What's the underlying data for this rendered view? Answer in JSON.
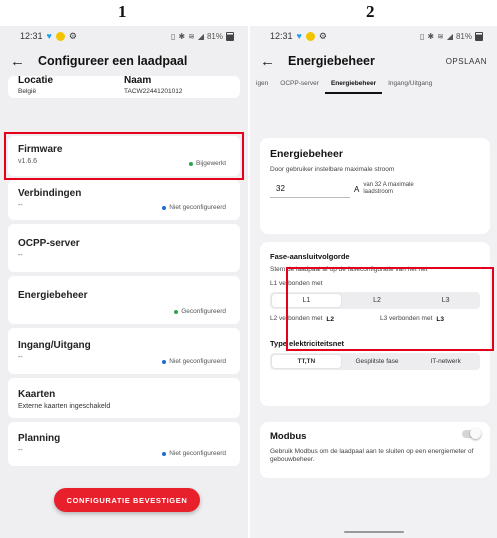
{
  "labels": {
    "step1": "1",
    "step2": "2"
  },
  "status_bar": {
    "time": "12:31",
    "battery": "81%",
    "icons_left": [
      "twitter-bird-icon",
      "sun-icon",
      "app-icon"
    ],
    "icons_right": [
      "vibrate-icon",
      "mute-icon",
      "bluetooth-icon",
      "wifi-icon",
      "signal-icon",
      "battery-icon"
    ]
  },
  "screen1": {
    "title": "Configureer een laadpaal",
    "info": [
      {
        "title": "Locatie",
        "value": "België"
      },
      {
        "title": "Naam",
        "value": "TACW22441201012"
      }
    ],
    "menu": [
      {
        "title": "Firmware",
        "value": "v1.6.6",
        "status": "Bijgewerkt",
        "status_color": "#2ea44f"
      },
      {
        "title": "Verbindingen",
        "value": "--",
        "status": "Niet geconfigureerd",
        "status_color": "#1f6bd6"
      },
      {
        "title": "OCPP-server",
        "value": "--",
        "status": "",
        "status_color": ""
      },
      {
        "title": "Energiebeheer",
        "value": "",
        "status": "Geconfigureerd",
        "status_color": "#2ea44f"
      },
      {
        "title": "Ingang/Uitgang",
        "value": "--",
        "status": "Niet geconfigureerd",
        "status_color": "#1f6bd6"
      },
      {
        "title": "Kaarten",
        "value": "Externe kaarten ingeschakeld",
        "status": "",
        "status_color": ""
      },
      {
        "title": "Planning",
        "value": "--",
        "status": "Niet geconfigureerd",
        "status_color": "#1f6bd6"
      }
    ],
    "confirm_label": "CONFIGURATIE BEVESTIGEN"
  },
  "screen2": {
    "title": "Energiebeheer",
    "action": "OPSLAAN",
    "tabs": [
      "igen",
      "OCPP-server",
      "Energiebeheer",
      "Ingang/Uitgang"
    ],
    "active_tab": 2,
    "energy": {
      "title": "Energiebeheer",
      "desc": "Door gebruiker instelbare maximale stroom",
      "value": "32",
      "unit": "A",
      "hint": "van 32 A maximale laadstroom"
    },
    "phase": {
      "title": "Fase-aansluitvolgorde",
      "desc": "Stem de laadpaal af op de faseconfiguratie van het net",
      "l1_label": "L1 verbonden met",
      "options": [
        "L1",
        "L2",
        "L3"
      ],
      "selected": 0,
      "l2_label": "L2 verbonden met",
      "l2_value": "L2",
      "l3_label": "L3 verbonden met",
      "l3_value": "L3"
    },
    "network": {
      "title": "Type elektriciteitsnet",
      "options": [
        "TT,TN",
        "Gesplitste fase",
        "IT-netwerk"
      ],
      "selected": 0
    },
    "modbus": {
      "title": "Modbus",
      "desc": "Gebruik Modbus om de laadpaal aan te sluiten op een energiemeter of gebouwbeheer.",
      "enabled": false
    }
  },
  "colors": {
    "highlight": "#e4001b",
    "accent": "#e8202b",
    "ok": "#2ea44f",
    "info": "#1f6bd6"
  }
}
